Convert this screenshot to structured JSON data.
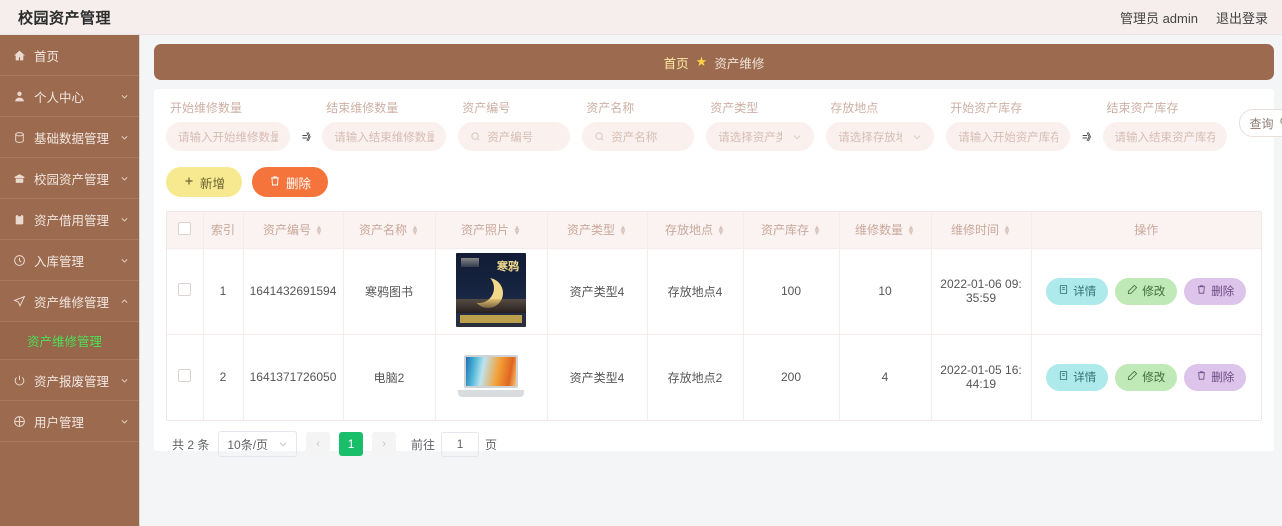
{
  "topbar": {
    "brand": "校园资产管理",
    "user": "管理员 admin",
    "logout": "退出登录"
  },
  "sidebar": {
    "items": [
      {
        "label": "首页",
        "icon": "home-icon",
        "arrow": false
      },
      {
        "label": "个人中心",
        "icon": "user-icon",
        "arrow": true
      },
      {
        "label": "基础数据管理",
        "icon": "database-icon",
        "arrow": true
      },
      {
        "label": "校园资产管理",
        "icon": "box-icon",
        "arrow": true
      },
      {
        "label": "资产借用管理",
        "icon": "clipboard-icon",
        "arrow": true
      },
      {
        "label": "入库管理",
        "icon": "clock-icon",
        "arrow": true
      },
      {
        "label": "资产维修管理",
        "icon": "send-icon",
        "arrow": true,
        "expanded": true,
        "children": [
          {
            "label": "资产维修管理",
            "active": true
          }
        ]
      },
      {
        "label": "资产报废管理",
        "icon": "power-icon",
        "arrow": true
      },
      {
        "label": "用户管理",
        "icon": "compass-icon",
        "arrow": true
      }
    ]
  },
  "breadcrumb": {
    "home": "首页",
    "star": "★",
    "current": "资产维修"
  },
  "filters": {
    "repair_start": {
      "label": "开始维修数量",
      "placeholder": "请输入开始维修数量",
      "value": ""
    },
    "repair_end": {
      "label": "结束维修数量",
      "placeholder": "请输入结束维修数量",
      "value": ""
    },
    "asset_code": {
      "label": "资产编号",
      "placeholder": "资产编号",
      "value": ""
    },
    "asset_name": {
      "label": "资产名称",
      "placeholder": "资产名称",
      "value": ""
    },
    "asset_type": {
      "label": "资产类型",
      "placeholder": "请选择资产类型",
      "value": ""
    },
    "location": {
      "label": "存放地点",
      "placeholder": "请选择存放地点",
      "value": ""
    },
    "stock_start": {
      "label": "开始资产库存",
      "placeholder": "请输入开始资产库存",
      "value": ""
    },
    "stock_end": {
      "label": "结束资产库存",
      "placeholder": "请输入结束资产库存",
      "value": ""
    },
    "separator": "=》",
    "query_button": "查询"
  },
  "toolbar": {
    "add_label": "新增",
    "delete_label": "删除"
  },
  "table": {
    "headers": [
      {
        "label": "索引",
        "sortable": false
      },
      {
        "label": "资产编号",
        "sortable": true
      },
      {
        "label": "资产名称",
        "sortable": true
      },
      {
        "label": "资产照片",
        "sortable": true
      },
      {
        "label": "资产类型",
        "sortable": true
      },
      {
        "label": "存放地点",
        "sortable": true
      },
      {
        "label": "资产库存",
        "sortable": true
      },
      {
        "label": "维修数量",
        "sortable": true
      },
      {
        "label": "维修时间",
        "sortable": true
      },
      {
        "label": "操作",
        "sortable": false
      }
    ],
    "rows": [
      {
        "index": "1",
        "code": "1641432691594",
        "name": "寒鸦图书",
        "photo": "book-cover-thumbnail",
        "photo_title": "寒鸦",
        "type": "资产类型4",
        "location": "存放地点4",
        "stock": "100",
        "repair_qty": "10",
        "repair_time": "2022-01-06 09:35:59"
      },
      {
        "index": "2",
        "code": "1641371726050",
        "name": "电脑2",
        "photo": "laptop-thumbnail",
        "photo_title": "",
        "type": "资产类型4",
        "location": "存放地点2",
        "stock": "200",
        "repair_qty": "4",
        "repair_time": "2022-01-05 16:44:19"
      }
    ],
    "ops": {
      "detail": "详情",
      "edit": "修改",
      "delete": "删除"
    }
  },
  "pagination": {
    "total_text": "共 2 条",
    "page_size": "10条/页",
    "prev": "‹",
    "next": "›",
    "current_page": "1",
    "jump_label": "前往",
    "jump_value": "1",
    "jump_unit": "页"
  },
  "colors": {
    "sidebar_bg": "#9c6b4f",
    "topbar_bg": "#f5eeec",
    "active_submenu": "#53e35a",
    "add_button": "#f6e98f",
    "delete_button": "#f4743b",
    "pager_active": "#19be6b",
    "filter_input_bg": "#faf0ee"
  }
}
